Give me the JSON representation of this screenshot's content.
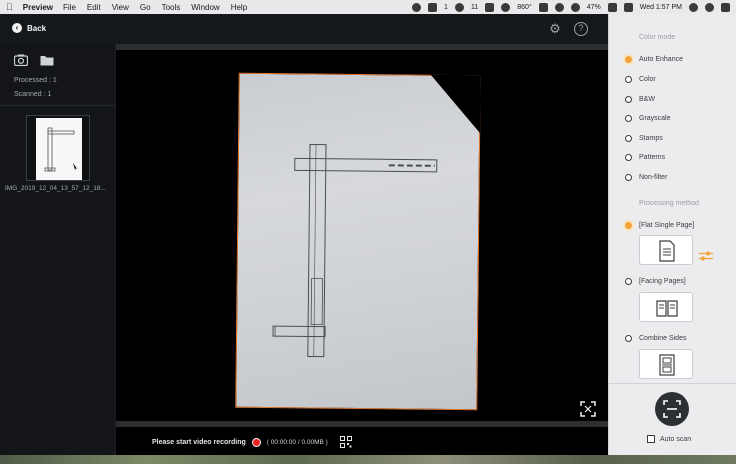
{
  "menubar": {
    "app_name": "Preview",
    "menus": [
      "File",
      "Edit",
      "View",
      "Go",
      "Tools",
      "Window",
      "Help"
    ],
    "status_text_1": "1",
    "status_text_2": "11",
    "net_speed": "860°",
    "battery": "47%",
    "clock": "Wed 1:57 PM"
  },
  "toolbar": {
    "back_label": "Back"
  },
  "sidebar": {
    "processed_label": "Processed :",
    "processed_count": "1",
    "scanned_label": "Scanned :",
    "scanned_count": "1",
    "thumbnail_label": "IMG_2019_12_04_13_57_12_18..."
  },
  "canvas": {
    "record_label": "Please start video recording",
    "record_time": "( 00:00:00 / 0.00MB )"
  },
  "panel": {
    "color_mode_title": "Color mode",
    "color_modes": [
      "Auto Enhance",
      "Color",
      "B&W",
      "Grayscale",
      "Stamps",
      "Patterns",
      "Non-filter"
    ],
    "selected_color_mode": "Auto Enhance",
    "processing_method_title": "Processing method",
    "processing_methods": [
      "[Flat Single Page]",
      "[Facing Pages]",
      "Combine Sides"
    ],
    "selected_processing_method": "[Flat Single Page]",
    "auto_scan_label": "Auto scan",
    "auto_scan_checked": false
  },
  "colors": {
    "accent": "#f2a33a",
    "crop_border": "#e0782d",
    "record": "#e22222"
  }
}
